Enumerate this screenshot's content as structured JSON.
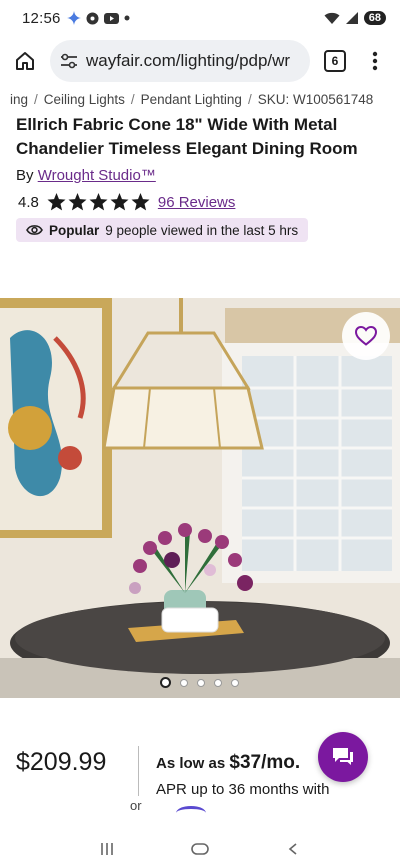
{
  "status_bar": {
    "time": "12:56",
    "battery": "68"
  },
  "browser": {
    "url": "wayfair.com/lighting/pdp/wr",
    "tab_count": "6"
  },
  "breadcrumb": {
    "items": [
      "ing",
      "Ceiling Lights",
      "Pendant Lighting",
      "SKU: W100561748"
    ]
  },
  "product": {
    "title": "Ellrich Fabric Cone 18\" Wide With Metal Chandelier Timeless Elegant Dining Room",
    "by_label": "By",
    "brand": "Wrought Studio™",
    "rating": "4.8",
    "star_count": 5,
    "reviews_label": "96 Reviews",
    "popular_label": "Popular",
    "popular_text": "9 people viewed in the last 5 hrs"
  },
  "gallery": {
    "total_images": 5,
    "active_index": 0
  },
  "pricing": {
    "price": "$209.99",
    "or_label": "or",
    "as_low_as_label": "As low as",
    "monthly_amount": "$37/mo.",
    "apr_text": "APR up to 36 months with"
  },
  "colors": {
    "accent_purple": "#7b189f",
    "link_purple": "#6a2b8a",
    "badge_bg": "#efe3f3"
  }
}
